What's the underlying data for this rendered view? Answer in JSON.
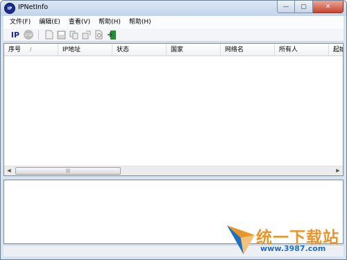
{
  "window": {
    "title": "IPNetInfo",
    "icon_text": "IP"
  },
  "caption": {
    "minimize": "—",
    "maximize": "▢",
    "close": "✕"
  },
  "menu": [
    "文件(F)",
    "编辑(E)",
    "查看(V)",
    "帮助(H)",
    "帮助(H)"
  ],
  "toolbar": {
    "ip_label": "IP",
    "stop_label": "STOP"
  },
  "columns": [
    "序号",
    "IP地址",
    "状态",
    "国家",
    "网络名",
    "所有人",
    "起始"
  ],
  "sort_indicator": "/",
  "scrollbar": {
    "left": "◀",
    "right": "▶",
    "thumb": "|||"
  },
  "watermark": {
    "text": "统一下载站",
    "url": "www.3987.com"
  }
}
